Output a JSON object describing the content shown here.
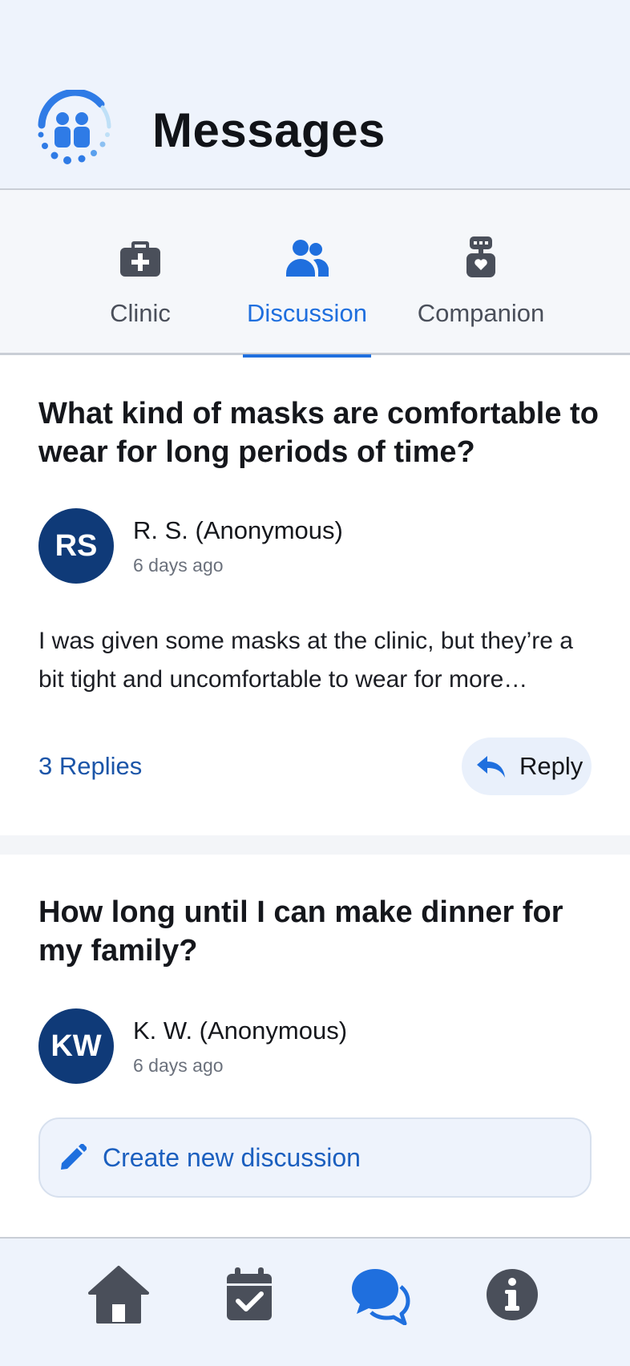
{
  "header": {
    "title": "Messages",
    "logo": "community-logo-icon"
  },
  "tabs": [
    {
      "label": "Clinic",
      "icon": "medical-kit-icon",
      "active": false
    },
    {
      "label": "Discussion",
      "icon": "people-icon",
      "active": true
    },
    {
      "label": "Companion",
      "icon": "robot-heart-icon",
      "active": false
    }
  ],
  "posts": [
    {
      "title": "What kind of masks are comfortable to wear for long periods of time?",
      "initials": "RS",
      "author": "R. S. (Anonymous)",
      "time": "6 days ago",
      "excerpt": "I was given some masks at the clinic, but they’re a bit tight and uncomfortable to wear for more…",
      "replies": "3 Replies",
      "reply_label": "Reply"
    },
    {
      "title": "How long until I can make dinner for my family?",
      "initials": "KW",
      "author": "K. W. (Anonymous)",
      "time": "6 days ago"
    }
  ],
  "create_discussion": {
    "label": "Create new discussion",
    "icon": "pencil-icon"
  },
  "bottom_nav": [
    {
      "icon": "home-icon",
      "active": false
    },
    {
      "icon": "calendar-check-icon",
      "active": false
    },
    {
      "icon": "chat-bubbles-icon",
      "active": true
    },
    {
      "icon": "info-icon",
      "active": false
    }
  ],
  "colors": {
    "accent": "#1f6fde",
    "avatar": "#0f3a78",
    "header_bg": "#eef3fc",
    "inactive_icon": "#4a4f5a"
  }
}
